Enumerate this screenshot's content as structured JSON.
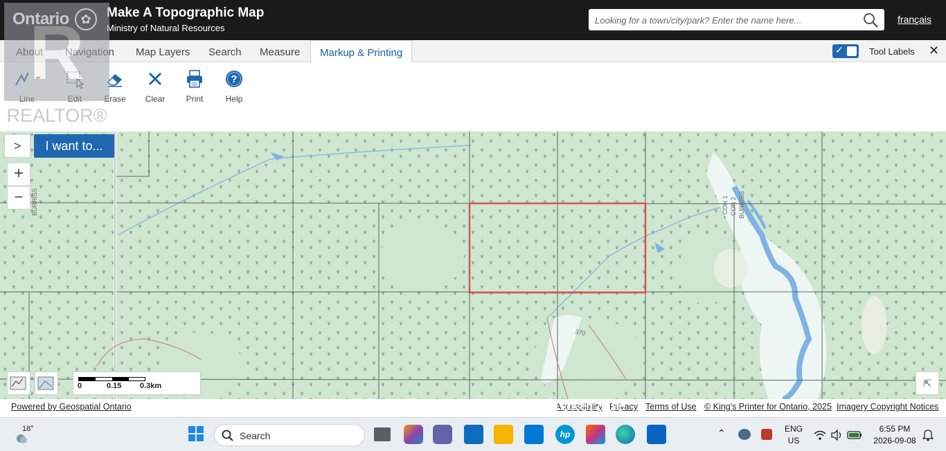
{
  "header": {
    "ontario": "Ontario",
    "title": "Make A Topographic Map",
    "subtitle": "Ministry of Natural Resources",
    "search_placeholder": "Looking for a town/city/park? Enter the name here...",
    "lang_link": "français"
  },
  "tabs": [
    {
      "label": "About"
    },
    {
      "label": "Navigation"
    },
    {
      "label": "Map Layers"
    },
    {
      "label": "Search"
    },
    {
      "label": "Measure"
    },
    {
      "label": "Markup & Printing",
      "active": true
    }
  ],
  "tool_labels": {
    "label": "Tool Labels",
    "checked": true
  },
  "toolbar": {
    "tools": [
      {
        "label": "Line",
        "icon": "line-icon"
      },
      {
        "label": "Edit",
        "icon": "edit-select-icon"
      },
      {
        "label": "Erase",
        "icon": "eraser-icon"
      },
      {
        "label": "Clear",
        "icon": "clear-x-icon"
      },
      {
        "label": "Print",
        "icon": "printer-icon"
      },
      {
        "label": "Help",
        "icon": "help-icon"
      }
    ]
  },
  "map": {
    "i_want_to": "I want to...",
    "zoom_in": "+",
    "zoom_out": "−",
    "expand": ">",
    "road_labels": [
      "BURRISS",
      "CON 1",
      "CON 2",
      "BURRISS",
      "370"
    ],
    "scale": {
      "ticks": [
        "0",
        "0.15",
        "0.3km"
      ]
    },
    "colors": {
      "land": "#cfe6d1",
      "water": "#7fb2e5",
      "selection": "#d9534f",
      "grid": "#5b6b5f"
    }
  },
  "footer": {
    "powered": "Powered by Geospatial Ontario",
    "accessibility": "Accessibility",
    "privacy": "Privacy",
    "terms": "Terms of Use",
    "printer": "© King's Printer for Ontario, 2025",
    "imagery": "Imagery Copyright Notices"
  },
  "watermarks": {
    "realtor": "REALTOR®",
    "homelife": "HOMELIFE OPTIMUM REALTY Brokerage"
  },
  "taskbar": {
    "weather": "18°",
    "search": "Search",
    "lang_top": "ENG",
    "lang_bottom": "US",
    "time": "6:55 PM",
    "date": "2026-09-08"
  }
}
